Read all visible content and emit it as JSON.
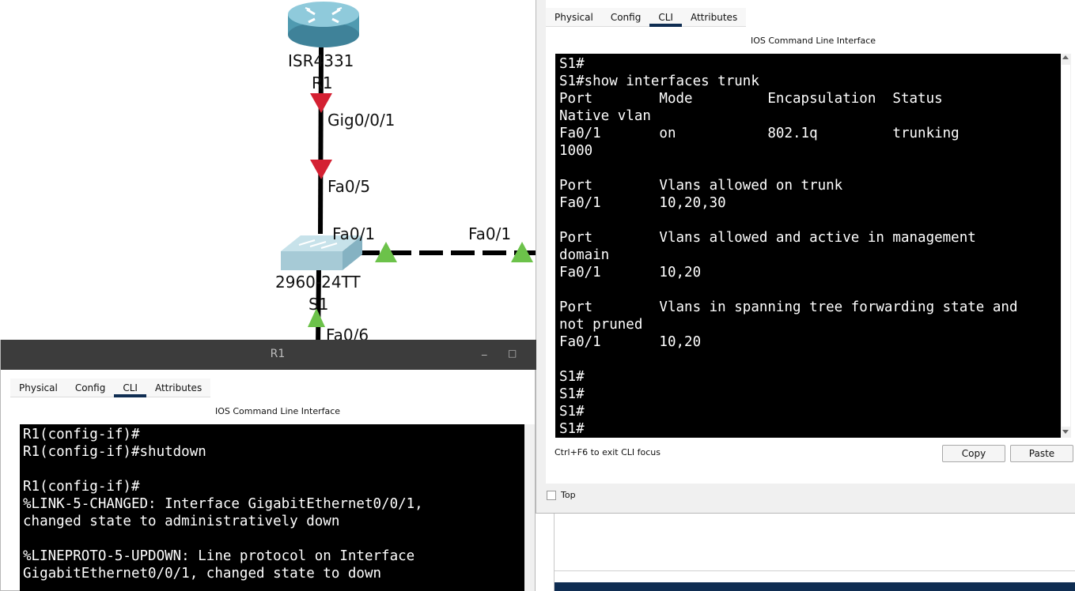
{
  "topology": {
    "router": {
      "model": "ISR4331",
      "name": "R1"
    },
    "switch": {
      "model": "2960-24TT",
      "name": "S1"
    },
    "ports": {
      "r1_gig": "Gig0/0/1",
      "s1_fa05": "Fa0/5",
      "s1_fa01": "Fa0/1",
      "remote_fa01": "Fa0/1",
      "s1_fa06": "Fa0/6"
    },
    "colors": {
      "link_down": "#d42032",
      "link_up": "#6cc24a",
      "cable": "#000000"
    }
  },
  "s1_window": {
    "tabs": [
      "Physical",
      "Config",
      "CLI",
      "Attributes"
    ],
    "active_tab": "CLI",
    "cli_title": "IOS Command Line Interface",
    "terminal_lines": [
      "S1#",
      "S1#show interfaces trunk",
      "Port        Mode         Encapsulation  Status",
      "Native vlan",
      "Fa0/1       on           802.1q         trunking",
      "1000",
      "",
      "Port        Vlans allowed on trunk",
      "Fa0/1       10,20,30",
      "",
      "Port        Vlans allowed and active in management",
      "domain",
      "Fa0/1       10,20",
      "",
      "Port        Vlans in spanning tree forwarding state and",
      "not pruned",
      "Fa0/1       10,20",
      "",
      "S1#",
      "S1#",
      "S1#",
      "S1#"
    ],
    "focus_hint": "Ctrl+F6 to exit CLI focus",
    "copy_label": "Copy",
    "paste_label": "Paste",
    "top_label": "Top",
    "top_checked": false
  },
  "r1_window": {
    "title": "R1",
    "minimize_glyph": "_",
    "maximize_glyph": "□",
    "tabs": [
      "Physical",
      "Config",
      "CLI",
      "Attributes"
    ],
    "active_tab": "CLI",
    "cli_title": "IOS Command Line Interface",
    "terminal_lines": [
      "R1(config-if)#",
      "R1(config-if)#shutdown",
      "",
      "R1(config-if)#",
      "%LINK-5-CHANGED: Interface GigabitEthernet0/0/1,",
      "changed state to administratively down",
      "",
      "%LINEPROTO-5-UPDOWN: Line protocol on Interface",
      "GigabitEthernet0/0/1, changed state to down"
    ]
  }
}
